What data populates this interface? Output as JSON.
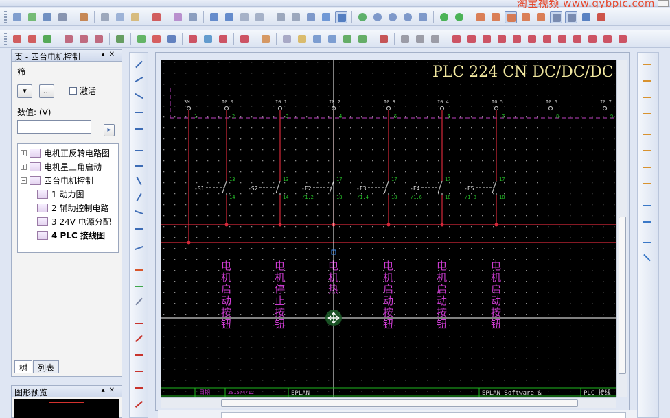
{
  "window": {
    "watermark": "淘宝视频 www.gybpic.com"
  },
  "left_panel": {
    "title": "页 - 四台电机控制",
    "filter_label": "筛",
    "filter_dropdown_button": "▾",
    "filter_more_button": "...",
    "activate_label": "激活",
    "value_label": "数值: (V)",
    "value_input": "",
    "apply_button": "▸",
    "tree": [
      {
        "label": "电机正反转电路图",
        "expander": "+",
        "level": 0,
        "icon": "page"
      },
      {
        "label": "电机星三角启动",
        "expander": "+",
        "level": 0,
        "icon": "page"
      },
      {
        "label": "四台电机控制",
        "expander": "−",
        "level": 0,
        "icon": "page"
      },
      {
        "label": "1 动力图",
        "level": 1,
        "icon": "page"
      },
      {
        "label": "2 辅助控制电路",
        "level": 1,
        "icon": "page"
      },
      {
        "label": "3 24V 电源分配",
        "level": 1,
        "icon": "page"
      },
      {
        "label": "4 PLC 接线图",
        "level": 1,
        "icon": "page",
        "selected": true
      }
    ],
    "tabs": [
      "树",
      "列表"
    ]
  },
  "preview_panel": {
    "title": "图形预览"
  },
  "drawing": {
    "title": "PLC 224 CN DC/DC/DC",
    "terminals": [
      {
        "name": "3M",
        "pin": "1"
      },
      {
        "name": "I0.0",
        "pin": "2"
      },
      {
        "name": "I0.1",
        "pin": "3"
      },
      {
        "name": "I0.2",
        "pin": "4"
      },
      {
        "name": "I0.3",
        "pin": "5"
      },
      {
        "name": "I0.4",
        "pin": "6"
      },
      {
        "name": "I0.5",
        "pin": "7"
      },
      {
        "name": "I0.6",
        "pin": "8"
      },
      {
        "name": "I0.7",
        "pin": "9"
      }
    ],
    "switches": [
      {
        "tag": "-S1",
        "top": "13",
        "bottom": "14",
        "ref": ""
      },
      {
        "tag": "-S2",
        "top": "13",
        "bottom": "14",
        "ref": ""
      },
      {
        "tag": "-F2",
        "top": "17",
        "bottom": "18",
        "ref": "/1.2"
      },
      {
        "tag": "-F3",
        "top": "17",
        "bottom": "18",
        "ref": "/1.4"
      },
      {
        "tag": "-F4",
        "top": "17",
        "bottom": "18",
        "ref": "/1.6"
      },
      {
        "tag": "-F5",
        "top": "17",
        "bottom": "18",
        "ref": "/1.8"
      }
    ],
    "descriptions": [
      "电机启动按钮",
      "电机停止按钮",
      "电机热",
      "电机启动按钮",
      "电机启动按钮",
      "电机启动按钮"
    ],
    "title_block": {
      "date_label": "日期",
      "date_value": "2015/4/12",
      "company": "EPLAN",
      "software": "EPLAN Software &",
      "page_name": "PLC 接线"
    }
  },
  "colors": {
    "wire": "#d6283a",
    "magenta_text": "#cc3bd1",
    "dash_line": "#c042c2",
    "terminal_text": "#c8c8c8",
    "green_text": "#27c22a",
    "title_text": "#f2e8a0",
    "frame_green": "#1fb81f"
  }
}
